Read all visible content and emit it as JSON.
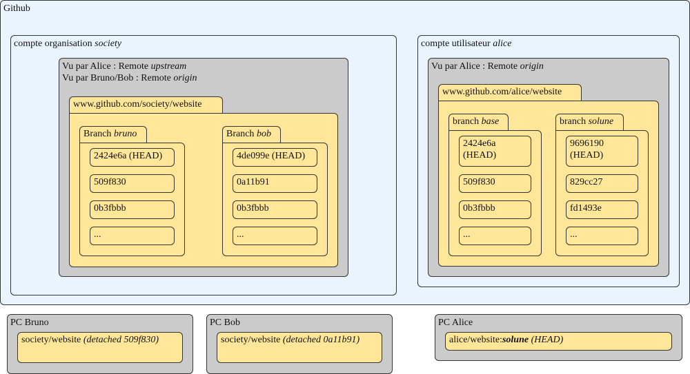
{
  "github": {
    "title": "Github",
    "org": {
      "label": "compte organisation",
      "name": "society",
      "remote_line1_prefix": "Vu par Alice : Remote",
      "remote_line1_name": "upstream",
      "remote_line2_prefix": "Vu par Bruno/Bob : Remote",
      "remote_line2_name": "origin",
      "repo": "www.github.com/society/website",
      "branches": [
        {
          "prefix": "Branch",
          "name": "bruno",
          "commits": [
            "2424e6a (HEAD)",
            "509f830",
            "0b3fbbb",
            "..."
          ]
        },
        {
          "prefix": "Branch",
          "name": "bob",
          "commits": [
            "4de099e (HEAD)",
            "0a11b91",
            "0b3fbbb",
            "..."
          ]
        }
      ]
    },
    "user": {
      "label": "compte utilisateur",
      "name": "alice",
      "remote_prefix": "Vu par Alice : Remote",
      "remote_name": "origin",
      "repo": "www.github.com/alice/website",
      "branches": [
        {
          "prefix": "branch",
          "name": "base",
          "commits": [
            "2424e6a (HEAD)",
            "509f830",
            "0b3fbbb",
            "..."
          ]
        },
        {
          "prefix": "branch",
          "name": "solune",
          "commits": [
            "9696190 (HEAD)",
            "829cc27",
            "fd1493e",
            "..."
          ]
        }
      ]
    }
  },
  "pcs": [
    {
      "title": "PC Bruno",
      "repo": "society/website",
      "note": "(detached 509f830)"
    },
    {
      "title": "PC Bob",
      "repo": "society/website",
      "note": "(detached 0a11b91)"
    },
    {
      "title": "PC Alice",
      "repo_prefix": "alice/website:",
      "branch": "solune",
      "note": "(HEAD)"
    }
  ]
}
